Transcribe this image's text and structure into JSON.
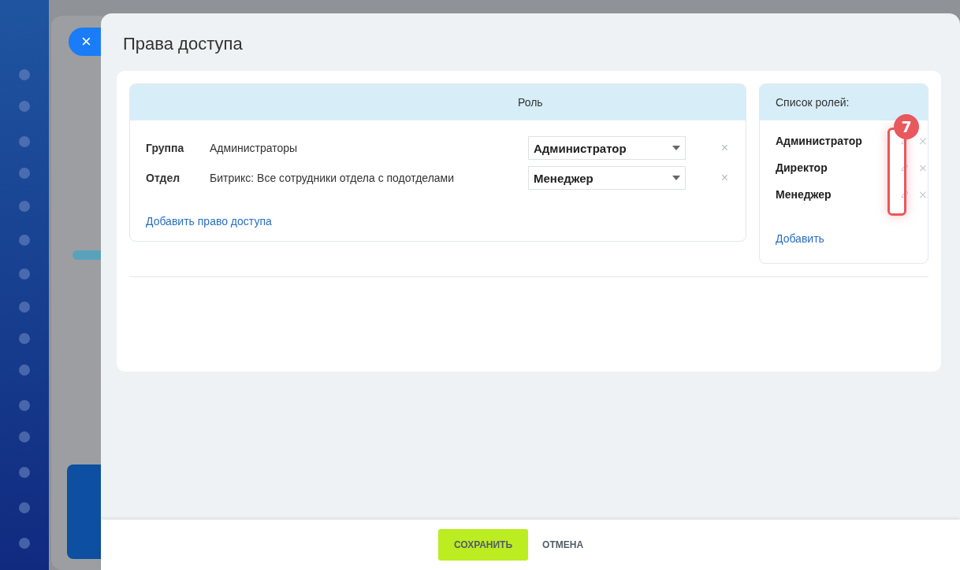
{
  "close_button": {
    "label": "×"
  },
  "panel": {
    "title": "Права доступа"
  },
  "access_table": {
    "columns": {
      "role": "Роль"
    },
    "rows": [
      {
        "type": "Группа",
        "name": "Администраторы",
        "role": "Администратор",
        "remove": "×"
      },
      {
        "type": "Отдел",
        "name": "Битрикс: Все сотрудники отдела с подотделами",
        "role": "Менеджер",
        "remove": "×"
      }
    ],
    "add_link": "Добавить право доступа"
  },
  "roles": {
    "title": "Список ролей:",
    "items": [
      {
        "name": "Администратор",
        "remove": "×"
      },
      {
        "name": "Директор",
        "remove": "×"
      },
      {
        "name": "Менеджер",
        "remove": "×"
      }
    ],
    "add_link": "Добавить",
    "annotation": {
      "badge": "7"
    }
  },
  "footer": {
    "buttons": [
      {
        "label": "СОХРАНИТЬ",
        "kind": "primary"
      },
      {
        "label": "ОТМЕНА",
        "kind": "link"
      }
    ]
  }
}
